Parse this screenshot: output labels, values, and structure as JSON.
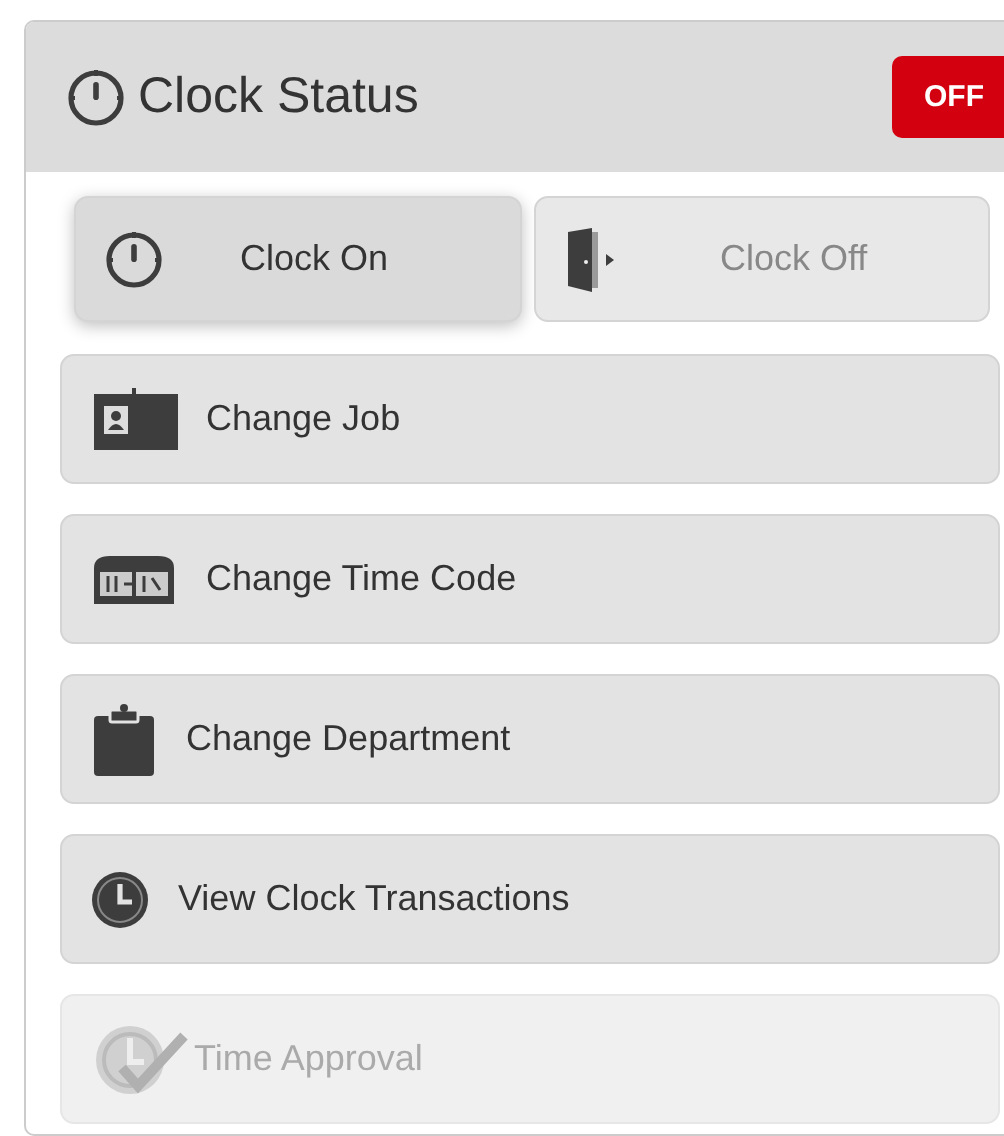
{
  "header": {
    "title": "Clock Status",
    "status": {
      "label": "OFF",
      "on": false
    }
  },
  "clock_buttons": [
    {
      "label": "Clock On",
      "kind": "stopwatch",
      "selected": true,
      "disabled": false
    },
    {
      "label": "Clock Off",
      "kind": "door",
      "selected": false,
      "disabled": true
    }
  ],
  "actions": [
    {
      "label": "Change Job",
      "kind": "badge",
      "disabled": false
    },
    {
      "label": "Change Time Code",
      "kind": "ticket",
      "disabled": false
    },
    {
      "label": "Change Department",
      "kind": "clipboard",
      "disabled": false
    },
    {
      "label": "View Clock Transactions",
      "kind": "clock",
      "disabled": false
    },
    {
      "label": "Time Approval",
      "kind": "approval",
      "disabled": true
    }
  ]
}
